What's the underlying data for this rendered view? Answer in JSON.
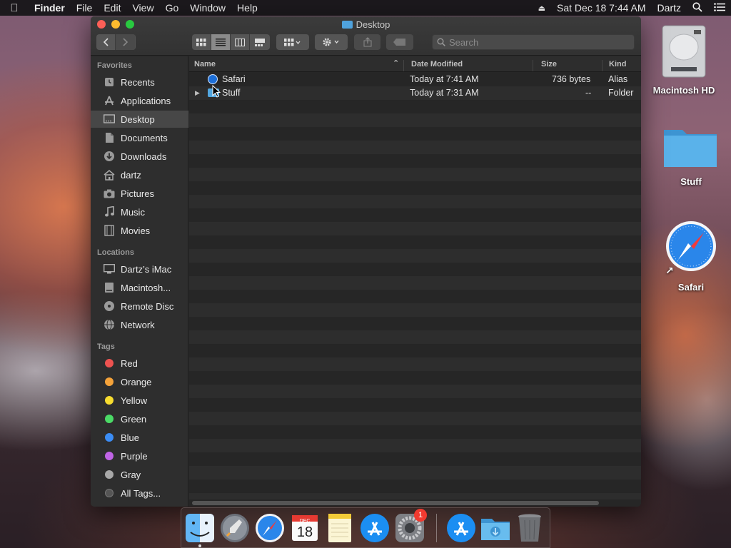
{
  "menubar": {
    "app_name": "Finder",
    "menus": [
      "File",
      "Edit",
      "View",
      "Go",
      "Window",
      "Help"
    ],
    "clock": "Sat Dec 18  7:44 AM",
    "user": "Dartz"
  },
  "window": {
    "title": "Desktop",
    "search_placeholder": "Search"
  },
  "sidebar": {
    "favorites_header": "Favorites",
    "favorites": [
      "Recents",
      "Applications",
      "Desktop",
      "Documents",
      "Downloads",
      "dartz",
      "Pictures",
      "Music",
      "Movies"
    ],
    "active": "Desktop",
    "locations_header": "Locations",
    "locations": [
      "Dartz’s iMac",
      "Macintosh...",
      "Remote Disc",
      "Network"
    ],
    "tags_header": "Tags",
    "tags": [
      {
        "label": "Red",
        "color": "#ee5350"
      },
      {
        "label": "Orange",
        "color": "#f5a33a"
      },
      {
        "label": "Yellow",
        "color": "#f7dc2f"
      },
      {
        "label": "Green",
        "color": "#4bdb66"
      },
      {
        "label": "Blue",
        "color": "#3b8df5"
      },
      {
        "label": "Purple",
        "color": "#c064e6"
      },
      {
        "label": "Gray",
        "color": "#a8a8a8"
      },
      {
        "label": "All Tags...",
        "color": "#555555"
      }
    ]
  },
  "columns": {
    "name": "Name",
    "date": "Date Modified",
    "size": "Size",
    "kind": "Kind"
  },
  "files": [
    {
      "name": "Safari",
      "date": "Today at 7:41 AM",
      "size": "736 bytes",
      "kind": "Alias"
    },
    {
      "name": "Stuff",
      "date": "Today at 7:31 AM",
      "size": "--",
      "kind": "Folder"
    }
  ],
  "desktop": {
    "items": [
      "Macintosh HD",
      "Stuff",
      "Safari"
    ]
  },
  "dock": {
    "apps": [
      "finder-icon",
      "launchpad-icon",
      "safari-icon",
      "calendar-icon",
      "notes-icon",
      "app-store-icon",
      "system-preferences-icon",
      "app-store-downloads-icon",
      "downloads-folder-icon",
      "trash-icon"
    ],
    "calendar_month": "DEC",
    "calendar_day": "18",
    "prefs_badge": "1"
  }
}
